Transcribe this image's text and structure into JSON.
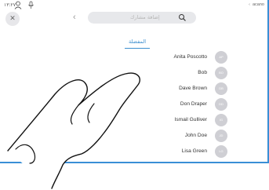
{
  "status_bar": {
    "time": "١٣:٢٧",
    "right_text": "acano"
  },
  "close_label": "✕",
  "search": {
    "placeholder": "إضافة مشارك",
    "back_label": "‹"
  },
  "tabs": {
    "favorites_label": "المفضلة"
  },
  "contacts": [
    {
      "name": "Anita Poscotto",
      "initials": "AP"
    },
    {
      "name": "Bob",
      "initials": "BO"
    },
    {
      "name": "Dave Brown",
      "initials": "DB"
    },
    {
      "name": "Don Draper",
      "initials": "DD"
    },
    {
      "name": "Ismail Gulliver",
      "initials": "IG"
    },
    {
      "name": "John Doe",
      "initials": "JD"
    },
    {
      "name": "Lisa Green",
      "initials": "LG"
    }
  ],
  "colors": {
    "accent": "#3d8fcf",
    "frame": "#3a8fd6",
    "avatar": "#cfcfd4"
  }
}
